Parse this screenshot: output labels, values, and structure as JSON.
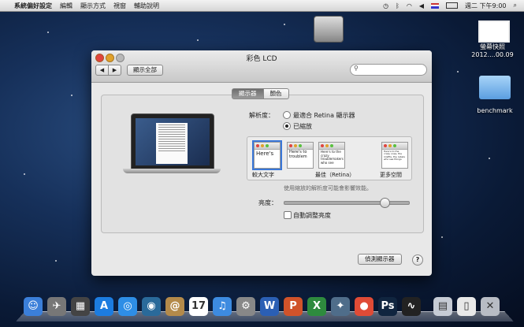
{
  "menubar": {
    "apple": "",
    "app_name": "系統偏好設定",
    "items": [
      "編輯",
      "顯示方式",
      "視窗",
      "輔助說明"
    ],
    "clock": "週二 下午9:00"
  },
  "desktop": {
    "screenshot_label_1": "螢幕快照",
    "screenshot_label_2": "2012....00.09",
    "folder_label": "benchmark"
  },
  "window": {
    "title": "彩色 LCD",
    "back_glyph": "◀",
    "forward_glyph": "▶",
    "show_all": "顯示全部",
    "search_placeholder": "",
    "tabs": [
      {
        "label": "顯示器"
      },
      {
        "label": "顏色"
      }
    ],
    "resolution": {
      "label": "解析度：",
      "option_best": "最適合 Retina 顯示器",
      "option_scaled": "已縮放",
      "selected": "option_scaled"
    },
    "scale_options": [
      {
        "sample": "Here's"
      },
      {
        "sample": "Here's to troublem"
      },
      {
        "sample": "Here's to the crazy troublemakers who see"
      },
      {
        "sample": "Here's to the crazy ones, the misfits, the rebels who see things"
      }
    ],
    "scale_labels": {
      "larger": "較大文字",
      "best": "最佳（Retina）",
      "more_space": "更多空間"
    },
    "hint": "使用縮放的解析度可能會影響效能。",
    "brightness": {
      "label": "亮度：",
      "value_fraction": 0.8,
      "auto_label": "自動調整亮度",
      "auto_checked": false
    },
    "detect_button": "偵測顯示器",
    "help": "?"
  },
  "dock": {
    "apps": [
      {
        "name": "finder",
        "glyph": "☺",
        "color": "#3b7fd9"
      },
      {
        "name": "launchpad",
        "glyph": "✈",
        "color": "#777"
      },
      {
        "name": "mission-control",
        "glyph": "▦",
        "color": "#444"
      },
      {
        "name": "app-store",
        "glyph": "A",
        "color": "#1c7ce0"
      },
      {
        "name": "safari",
        "glyph": "◎",
        "color": "#2e8ee6"
      },
      {
        "name": "facetime",
        "glyph": "◉",
        "color": "#2a6a9a"
      },
      {
        "name": "contacts",
        "glyph": "@",
        "color": "#b48a4a"
      },
      {
        "name": "calendar",
        "glyph": "17",
        "color": "#fff"
      },
      {
        "name": "itunes",
        "glyph": "♫",
        "color": "#3d8be0"
      },
      {
        "name": "system-preferences",
        "glyph": "⚙",
        "color": "#888"
      },
      {
        "name": "word",
        "glyph": "W",
        "color": "#2b5fb4"
      },
      {
        "name": "powerpoint",
        "glyph": "P",
        "color": "#d0532a"
      },
      {
        "name": "excel",
        "glyph": "X",
        "color": "#2e8b3e"
      },
      {
        "name": "satellite",
        "glyph": "✦",
        "color": "#4f6d8a"
      },
      {
        "name": "chrome",
        "glyph": "●",
        "color": "#e04b36"
      },
      {
        "name": "photoshop",
        "glyph": "Ps",
        "color": "#10253f"
      },
      {
        "name": "activity-monitor",
        "glyph": "∿",
        "color": "#222"
      },
      {
        "name": "documents-stack",
        "glyph": "▤",
        "color": "#c6cbd4"
      },
      {
        "name": "file-stack",
        "glyph": "▯",
        "color": "#e8e8e8"
      },
      {
        "name": "trash",
        "glyph": "✕",
        "color": "#b8bcc4"
      }
    ]
  }
}
